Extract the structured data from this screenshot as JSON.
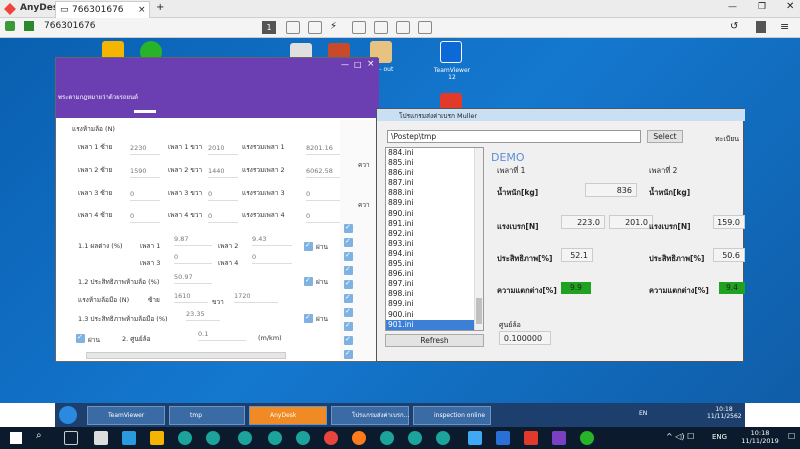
{
  "anydesk": {
    "app_name": "AnyDesk",
    "tab_title": "766301676",
    "address": "766301676",
    "new_tab": "+",
    "monitor_badge": "1"
  },
  "left_app": {
    "header_title": "พระตามกฎหมายว่าด้วยรถยนต์",
    "section_brake": "แรงห้ามล้อ (N)",
    "rows": [
      {
        "label": "เพลา 1 ซ้าย",
        "left": "2230",
        "mid_label": "เพลา 1 ขวา",
        "right": "2010",
        "sum_label": "แรงรวมเพลา 1",
        "sum": "8201.16"
      },
      {
        "label": "เพลา 2 ซ้าย",
        "left": "1590",
        "mid_label": "เพลา 2 ขวา",
        "right": "1440",
        "sum_label": "แรงรวมเพลา 2",
        "sum": "6062.58"
      },
      {
        "label": "เพลา 3 ซ้าย",
        "left": "0",
        "mid_label": "เพลา 3 ขวา",
        "right": "0",
        "sum_label": "แรงรวมเพลา 3",
        "sum": "0"
      },
      {
        "label": "เพลา 4 ซ้าย",
        "left": "0",
        "mid_label": "เพลา 4 ขวา",
        "right": "0",
        "sum_label": "แรงรวมเพลา 4",
        "sum": "0"
      }
    ],
    "diff_label": "1.1 ผลต่าง (%)",
    "axle1": "เพลา 1",
    "axle1_val": "9.87",
    "axle2": "เพลา 2",
    "axle2_val": "9.43",
    "axle3": "เพลา 3",
    "axle3_val": "0",
    "axle4": "เพลา 4",
    "axle4_val": "0",
    "pass": "ผ่าน",
    "eff_label": "1.2 ประสิทธิภาพห้ามล้อ (%)",
    "eff_val": "50.97",
    "hand_label": "แรงห้ามล้อมือ (N)",
    "hand_left": "ซ้าย",
    "hand_left_val": "1610",
    "hand_right": "ขวา",
    "hand_right_val": "1720",
    "hand_eff_label": "1.3 ประสิทธิภาพห้ามล้อมือ (%)",
    "hand_eff_val": "23.35",
    "zero_label": "2. ศูนย์ล้อ",
    "zero_val": "0.1",
    "zero_unit": "(m/km)",
    "side_labels": [
      "ควา",
      "ควา"
    ]
  },
  "muller": {
    "title": "โปรแกรมส่งค่าเบรก Muller",
    "path": "\\Postep\\tmp",
    "select_label": "Select",
    "reg_label": "ทะเบียน",
    "files": [
      "884.ini",
      "885.ini",
      "886.ini",
      "887.ini",
      "888.ini",
      "889.ini",
      "890.ini",
      "891.ini",
      "892.ini",
      "893.ini",
      "894.ini",
      "895.ini",
      "896.ini",
      "897.ini",
      "898.ini",
      "899.ini",
      "900.ini",
      "901.ini"
    ],
    "selected_file": "901.ini",
    "refresh_label": "Refresh",
    "demo": "DEMO",
    "axle1": "เพลาที่ 1",
    "axle2": "เพลาที่ 2",
    "weight_label": "น้ำหนัก[kg]",
    "weight1": "836",
    "brake_label": "แรงเบรก[N]",
    "brake1_l": "223.0",
    "brake1_r": "201.0",
    "brake2_l": "159.0",
    "eff_label": "ประสิทธิภาพ[%]",
    "eff1": "52.1",
    "eff2": "50.6",
    "diff_label": "ความแตกต่าง[%]",
    "diff1": "9.9",
    "diff2": "9.4",
    "zero_label": "ศูนย์ล้อ",
    "zero_val": "0.100000"
  },
  "remote_taskbar": {
    "buttons": [
      "TeamViewer",
      "tmp",
      "AnyDesk",
      "โปรแกรมส่งค่าเบรก...",
      "inspection online"
    ],
    "lang": "EN",
    "time": "10:18",
    "date": "11/11/2562"
  },
  "local_taskbar": {
    "lang": "ENG",
    "time": "10:18",
    "date": "11/11/2019"
  },
  "desktop": {
    "teamviewer_label": "TeamViewer 12",
    "other_label": "rnal - out"
  }
}
